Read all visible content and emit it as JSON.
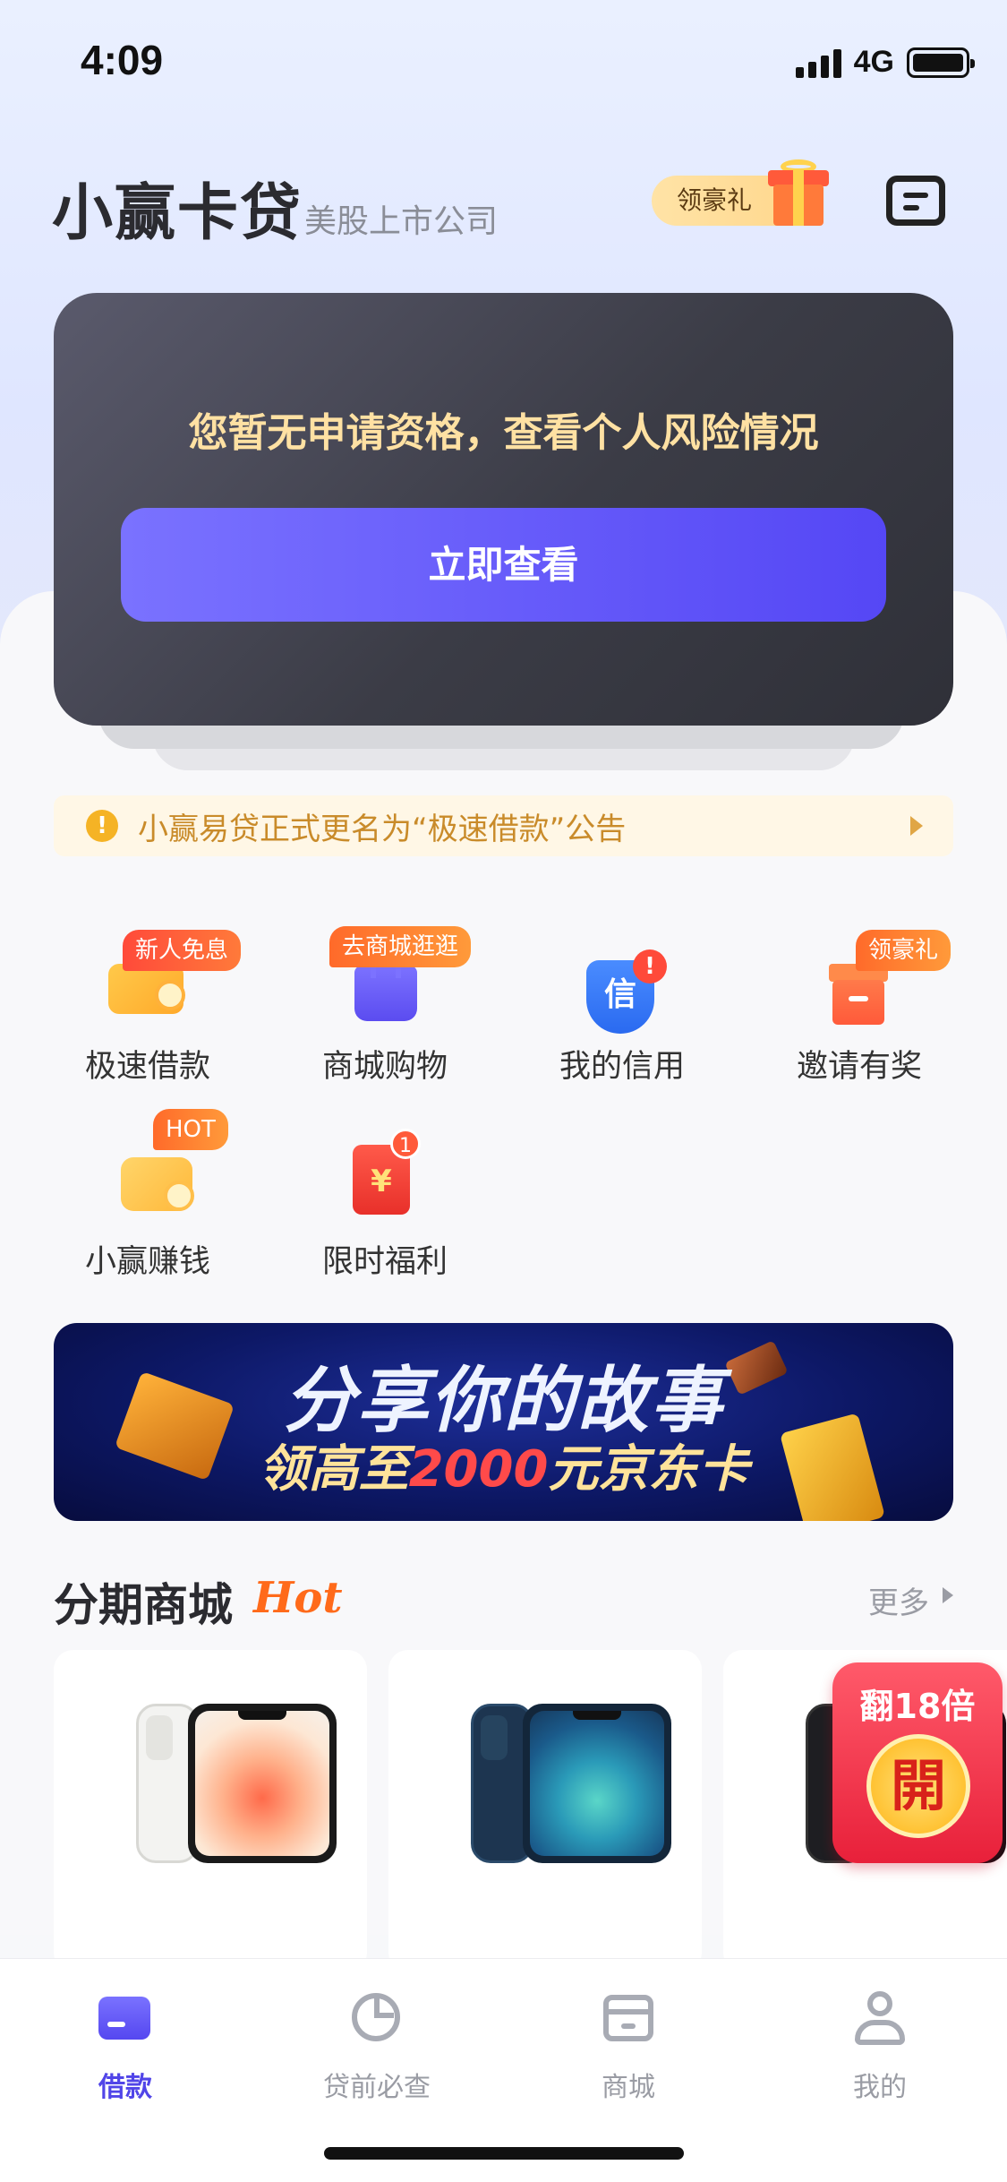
{
  "status_bar": {
    "time": "4:09",
    "network": "4G"
  },
  "header": {
    "title": "小赢卡贷",
    "subtitle": "美股上市公司",
    "gift_badge": "领豪礼"
  },
  "risk_card": {
    "message": "您暂无申请资格，查看个人风险情况",
    "button": "立即查看"
  },
  "notice": {
    "text": "小赢易贷正式更名为“极速借款”公告"
  },
  "services": [
    {
      "label": "极速借款",
      "tag": "新人免息"
    },
    {
      "label": "商城购物",
      "tag": "去商城逛逛"
    },
    {
      "label": "我的信用",
      "badge": "!",
      "glyph": "信"
    },
    {
      "label": "邀请有奖",
      "tag": "领豪礼"
    },
    {
      "label": "小赢赚钱",
      "tag": "HOT"
    },
    {
      "label": "限时福利",
      "badge": "1",
      "glyph": "¥"
    }
  ],
  "banner": {
    "line1": "分享你的故事",
    "line2_prefix": "领高至",
    "line2_amount": "2000",
    "line2_suffix": "元京东卡"
  },
  "mall": {
    "title": "分期商城",
    "hot": "Hot",
    "more": "更多"
  },
  "promo": {
    "text": "翻18倍",
    "coin": "開"
  },
  "tabs": [
    {
      "label": "借款",
      "icon": "card-icon",
      "active": true
    },
    {
      "label": "贷前必查",
      "icon": "pie-chart-icon",
      "active": false
    },
    {
      "label": "商城",
      "icon": "store-icon",
      "active": false
    },
    {
      "label": "我的",
      "icon": "user-icon",
      "active": false
    }
  ],
  "colors": {
    "accent": "#5145e8",
    "card_text": "#ffe1a3",
    "hot": "#ff6a1a"
  }
}
